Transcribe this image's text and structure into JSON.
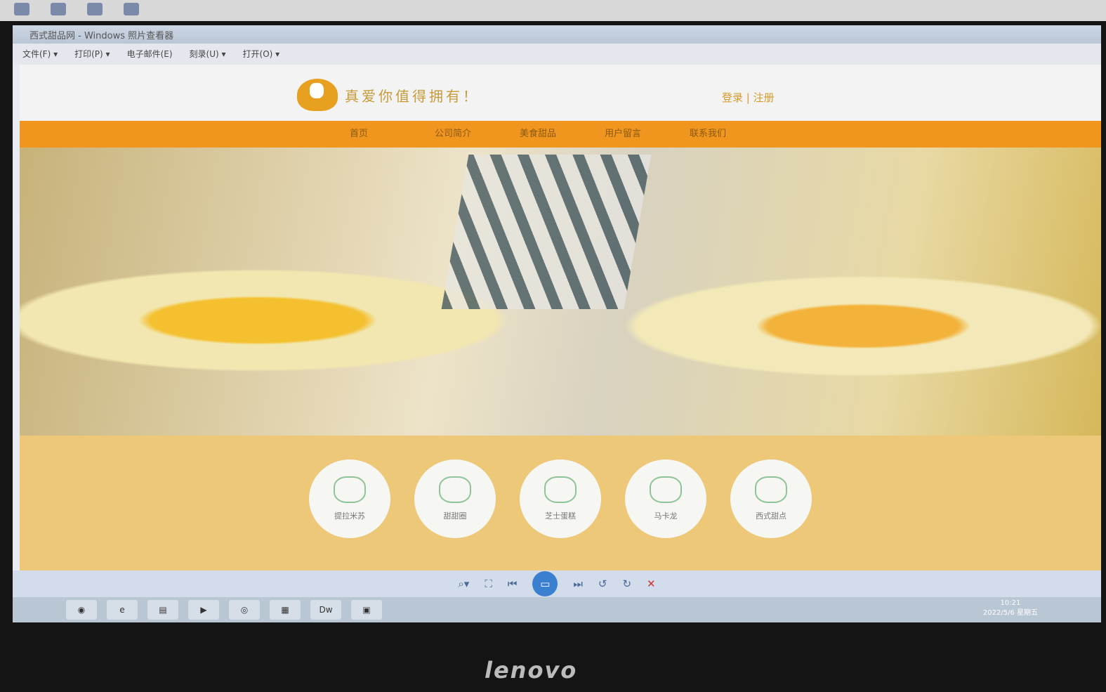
{
  "window": {
    "title": "西式甜品网 - Windows 照片查看器",
    "menu": [
      "文件(F) ▾",
      "打印(P) ▾",
      "电子邮件(E)",
      "刻录(U) ▾",
      "打开(O) ▾"
    ]
  },
  "site": {
    "slogan": "真爱你值得拥有！",
    "login": "登录",
    "register": "注册",
    "separator": "|",
    "nav": [
      "首页",
      "公司简介",
      "美食甜品",
      "用户留言",
      "联系我们"
    ],
    "categories": [
      "提拉米苏",
      "甜甜圈",
      "芝士蛋糕",
      "马卡龙",
      "西式甜点"
    ]
  },
  "viewer": {
    "controls": [
      "⌕▾",
      "⛶",
      "⏮",
      "⏭",
      "↺",
      "↻",
      "✕"
    ],
    "play": "▭"
  },
  "taskbar": {
    "apps": [
      "◉",
      "e",
      "▤",
      "▶",
      "◎",
      "▦",
      "Dw",
      "▣"
    ],
    "time": "10:21",
    "date": "2022/5/6 星期五"
  },
  "monitor": {
    "brand": "lenovo"
  }
}
